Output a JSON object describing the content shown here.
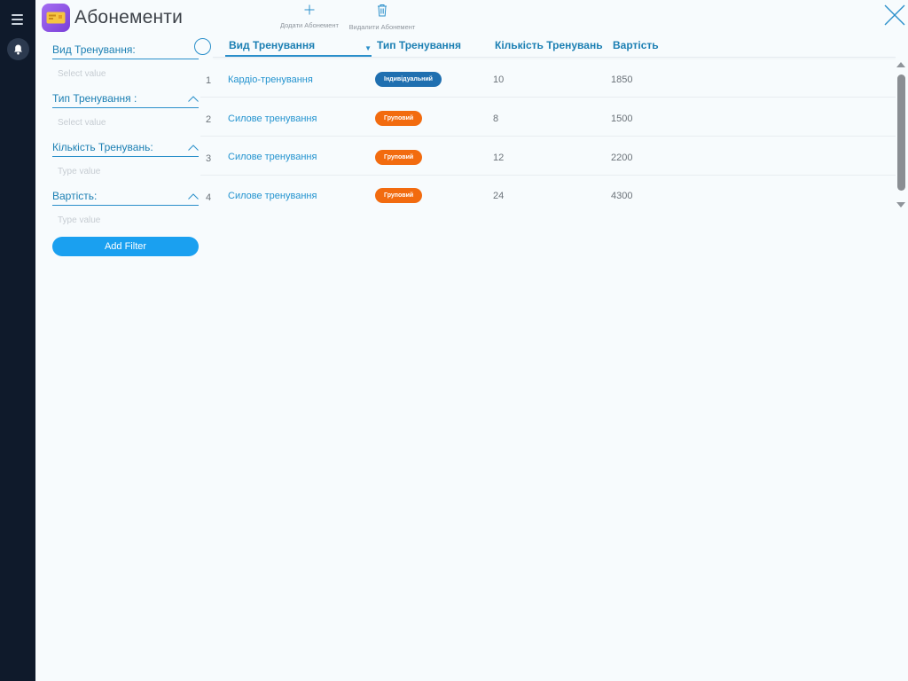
{
  "app": {
    "title": "Абонементи",
    "icon": "ticket-icon"
  },
  "toolbar": {
    "add_label": "Додати Абонемент",
    "delete_label": "Видалити Абонемент"
  },
  "filters": [
    {
      "label": "Вид Тренування:",
      "placeholder": "Select value"
    },
    {
      "label": "Тип Тренування :",
      "placeholder": "Select value"
    },
    {
      "label": "Кількість Тренувань:",
      "placeholder": "Type value"
    },
    {
      "label": "Вартість:",
      "placeholder": "Type value"
    }
  ],
  "add_filter_label": "Add Filter",
  "table": {
    "columns": [
      "Вид Тренування",
      "Тип Тренування",
      "Кількість Тренувань",
      "Вартість"
    ],
    "rows": [
      {
        "num": "1",
        "vid": "Кардіо-тренування",
        "type": "Індивідуальний",
        "count": "10",
        "price": "1850"
      },
      {
        "num": "2",
        "vid": "Силове тренування",
        "type": "Груповий",
        "count": "8",
        "price": "1500"
      },
      {
        "num": "3",
        "vid": "Силове тренування",
        "type": "Груповий",
        "count": "12",
        "price": "2200"
      },
      {
        "num": "4",
        "vid": "Силове тренування",
        "type": "Груповий",
        "count": "24",
        "price": "4300"
      }
    ]
  },
  "colors": {
    "accent": "#2a8fca",
    "rail": "#0f1a2b",
    "badge_individual": "#1f6fb0",
    "badge_group": "#f26b0f",
    "add_filter_button": "#1aa0f0"
  }
}
